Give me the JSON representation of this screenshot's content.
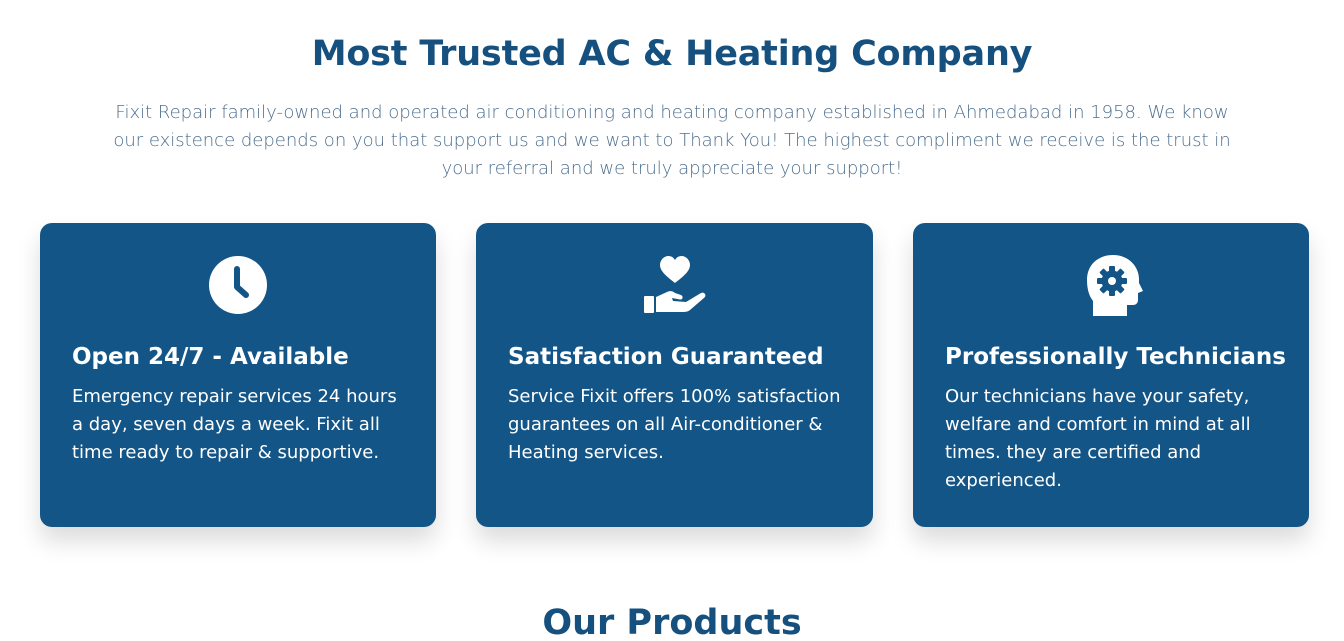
{
  "hero": {
    "title": "Most Trusted AC & Heating Company",
    "description": "Fixit Repair family-owned and operated air conditioning and heating company established in Ahmedabad in 1958. We know our existence depends on you that support us and we want to Thank You! The highest compliment we receive is the trust in your referral and we truly appreciate your support!"
  },
  "features": [
    {
      "icon": "clock-icon",
      "title": "Open 24/7 - Available",
      "description": "Emergency repair services 24 hours a day, seven days a week. Fixit all time ready to repair & supportive."
    },
    {
      "icon": "heart-hand-icon",
      "title": "Satisfaction Guaranteed",
      "description": "Service Fixit offers 100% satisfaction guarantees on all Air-conditioner & Heating services."
    },
    {
      "icon": "head-gear-icon",
      "title": "Professionally Technicians",
      "description": "Our technicians have your safety, welfare and comfort in mind at all times. they are certified and experienced."
    }
  ],
  "products": {
    "title": "Our Products"
  },
  "colors": {
    "primary": "#135587",
    "heading": "#15507f",
    "body_text": "#4d6f8f",
    "background": "#ffffff"
  }
}
